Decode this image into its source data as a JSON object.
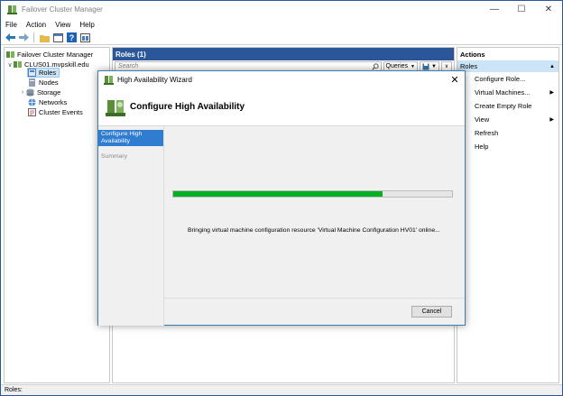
{
  "window": {
    "title": "Failover Cluster Manager",
    "controls": {
      "minimize": "—",
      "maximize": "☐",
      "close": "✕"
    }
  },
  "menu": [
    "File",
    "Action",
    "View",
    "Help"
  ],
  "toolbar": {
    "icons": [
      "back-arrow-icon",
      "forward-arrow-icon",
      "folder-up-icon",
      "console-tree-icon",
      "help-icon",
      "properties-icon"
    ]
  },
  "tree": {
    "root": "Failover Cluster Manager",
    "cluster": "CLUS01.mvpskill.edu",
    "items": [
      {
        "label": "Roles",
        "selected": true
      },
      {
        "label": "Nodes"
      },
      {
        "label": "Storage",
        "expandable": true
      },
      {
        "label": "Networks"
      },
      {
        "label": "Cluster Events"
      }
    ]
  },
  "center": {
    "header": "Roles (1)",
    "search_placeholder": "Search",
    "queries_label": "Queries"
  },
  "actions": {
    "header": "Actions",
    "sub_header": "Roles",
    "items": [
      {
        "label": "Configure Role...",
        "submenu": false
      },
      {
        "label": "Virtual Machines...",
        "submenu": true
      },
      {
        "label": "Create Empty Role",
        "submenu": false
      },
      {
        "label": "View",
        "submenu": true
      },
      {
        "label": "Refresh",
        "submenu": false
      },
      {
        "label": "Help",
        "submenu": false
      }
    ]
  },
  "status": {
    "text": "Roles:"
  },
  "dialog": {
    "title": "High Availability Wizard",
    "header": "Configure High Availability",
    "steps": [
      {
        "label": "Configure High Availability",
        "active": true
      },
      {
        "label": "Summary",
        "active": false
      }
    ],
    "progress_fraction": 0.75,
    "message": "Bringing virtual machine configuration resource 'Virtual Machine Configuration HV01' online...",
    "cancel_label": "Cancel",
    "close_glyph": "✕"
  },
  "colors": {
    "accent": "#2b579a",
    "progress_green": "#06b025",
    "selection": "#cce4f7",
    "active_step": "#2f7cd1"
  }
}
